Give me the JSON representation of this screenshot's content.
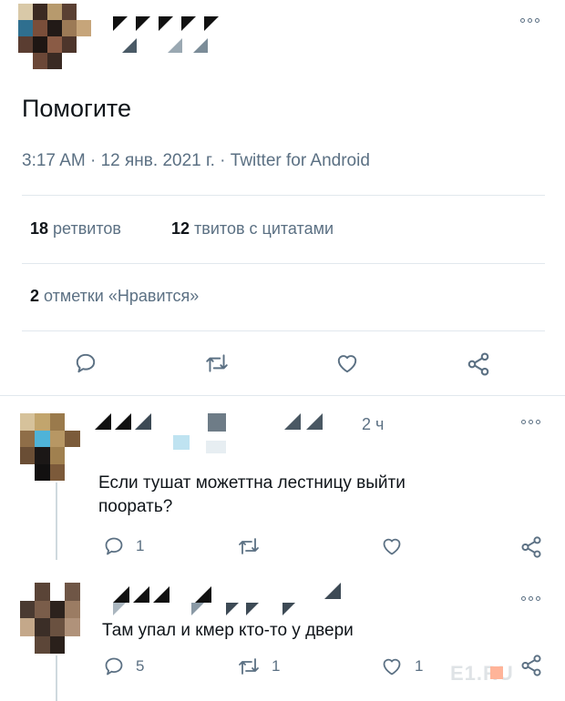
{
  "tweet": {
    "text": "Помогите",
    "meta": "3:17 AM · 12 янв. 2021 г. · Twitter for Android",
    "retweets_count": "18",
    "retweets_label": "ретвитов",
    "quotes_count": "12",
    "quotes_label": "твитов с цитатами",
    "likes_count": "2",
    "likes_label": "отметки «Нравится»"
  },
  "replies": [
    {
      "time": "2 ч",
      "text": "Если тушат можеттна лестницу выйти поорать?",
      "reply_count": "1",
      "retweet_count": "",
      "like_count": ""
    },
    {
      "time": "",
      "text": "Там упал и кмер кто-то у двери",
      "reply_count": "5",
      "retweet_count": "1",
      "like_count": "1"
    }
  ],
  "watermark": {
    "text": "E1.RU"
  },
  "icons": [
    "more-icon",
    "reply-icon",
    "retweet-icon",
    "like-icon",
    "share-icon"
  ],
  "colors": {
    "text": "#0f1419",
    "muted": "#5b7083",
    "divider": "#e1e8ed",
    "watermark": "#ff5a1f"
  }
}
